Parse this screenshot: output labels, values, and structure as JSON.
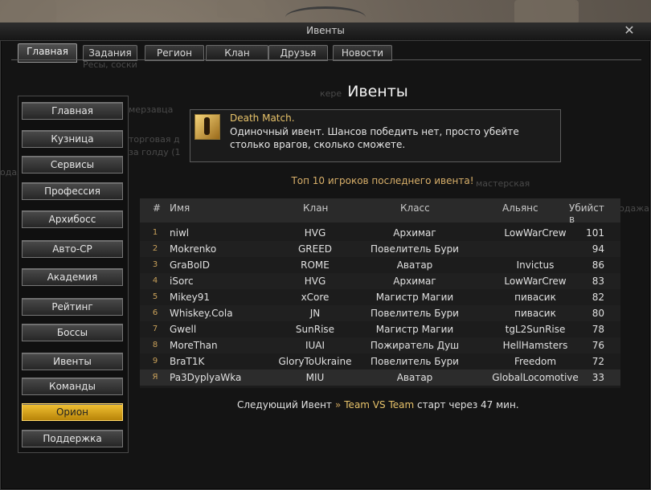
{
  "window": {
    "title": "Ивенты",
    "close_glyph": "✕"
  },
  "tabs": [
    {
      "label": "Главная",
      "active": true
    },
    {
      "label": "Задания",
      "active": false
    },
    {
      "label": "Регион",
      "active": false
    },
    {
      "label": "Клан",
      "active": false
    },
    {
      "label": "Друзья",
      "active": false
    },
    {
      "label": "Новости",
      "active": false
    }
  ],
  "ghost_texts": [
    "Ресы, соски",
    "кере",
    "мерзавца",
    "торговая д",
    "за голду (1",
    "мастерская",
    "продажа",
    "одаж"
  ],
  "sidebar": {
    "items": [
      {
        "label": "Главная",
        "active": false
      },
      {
        "label": "Кузница",
        "active": false
      },
      {
        "label": "Сервисы",
        "active": false
      },
      {
        "label": "Профессия",
        "active": false
      },
      {
        "label": "Архибосс",
        "active": false
      },
      {
        "label": "Авто-СР",
        "active": false
      },
      {
        "label": "Академия",
        "active": false
      },
      {
        "label": "Рейтинг",
        "active": false
      },
      {
        "label": "Боссы",
        "active": false
      },
      {
        "label": "Ивенты",
        "active": false
      },
      {
        "label": "Команды",
        "active": false
      },
      {
        "label": "Орион",
        "active": true
      },
      {
        "label": "Поддержка",
        "active": false
      }
    ]
  },
  "main": {
    "heading": "Ивенты",
    "event": {
      "icon": "death-match-icon",
      "name": "Death Match.",
      "description": " Одиночный ивент. Шансов победить нет, просто убейте столько врагов, сколько сможете."
    },
    "top_title": "Топ 10 игроков последнего ивента!",
    "table": {
      "headers": [
        "#",
        "Имя",
        "Клан",
        "Класс",
        "Альянс",
        "Убийств"
      ],
      "rows": [
        [
          "1",
          "niwl",
          "HVG",
          "Архимаг",
          "LowWarCrew",
          "101"
        ],
        [
          "2",
          "Mokrenko",
          "GREED",
          "Повелитель Бури",
          "",
          "94"
        ],
        [
          "3",
          "GraBoID",
          "ROME",
          "Аватар",
          "Invictus",
          "86"
        ],
        [
          "4",
          "iSorc",
          "HVG",
          "Архимаг",
          "LowWarCrew",
          "83"
        ],
        [
          "5",
          "Mikey91",
          "xCore",
          "Магистр Магии",
          "пивасик",
          "82"
        ],
        [
          "6",
          "Whiskey.Cola",
          "JN",
          "Повелитель Бури",
          "пивасик",
          "80"
        ],
        [
          "7",
          "Gwell",
          "SunRise",
          "Магистр Магии",
          "tgL2SunRise",
          "78"
        ],
        [
          "8",
          "MoreThan",
          "IUAI",
          "Пожиратель Душ",
          "HellHamsters",
          "76"
        ],
        [
          "9",
          "BraT1K",
          "GloryToUkraine",
          "Повелитель Бури",
          "Freedom",
          "72"
        ],
        [
          "Я",
          "Pa3DyplyaWka",
          "MIU",
          "Аватар",
          "GlobalLocomotive",
          "33"
        ]
      ]
    },
    "next_event": {
      "prefix": "Следующий Ивент",
      "arrow": "»",
      "event_name": "Team VS Team",
      "suffix": "старт через 47 мин."
    }
  },
  "colors": {
    "accent": "#e8c36a",
    "active_button": "#f2c233",
    "window_bg": "#141414"
  }
}
